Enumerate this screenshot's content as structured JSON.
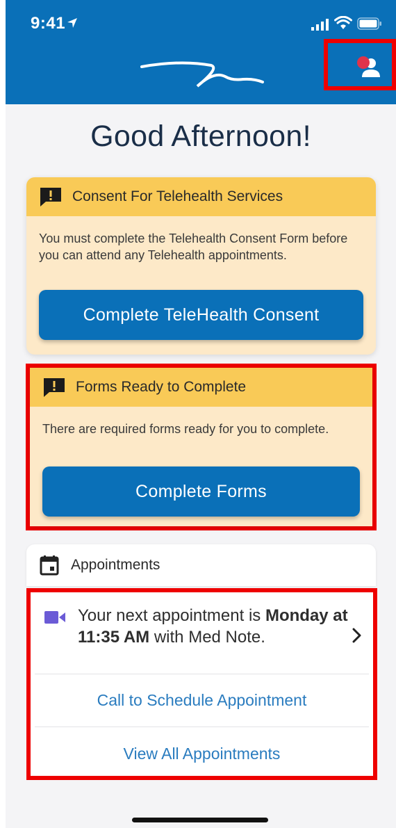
{
  "status_bar": {
    "time": "9:41"
  },
  "header": {
    "logo_icon": "brand-wave-logo",
    "profile_icon": "person-icon",
    "notification_color": "#e0334a",
    "background_color": "#0a70b8"
  },
  "greeting": "Good Afternoon!",
  "consent_card": {
    "title": "Consent For Telehealth Services",
    "message": "You must complete the Telehealth Consent Form before you can attend any Telehealth appointments.",
    "button_label": "Complete TeleHealth Consent"
  },
  "forms_card": {
    "title": "Forms Ready to Complete",
    "message": "There are required forms ready for you to complete.",
    "button_label": "Complete Forms"
  },
  "appointments": {
    "title": "Appointments",
    "next": {
      "prefix": "Your next appointment is",
      "when": "Monday at 11:35 AM",
      "mid": "with",
      "provider": "Med Note."
    },
    "call_link": "Call to Schedule Appointment",
    "view_link": "View All Appointments"
  },
  "colors": {
    "accent": "#0a70b8",
    "card_header": "#f9ca57",
    "card_body": "#fde9c8",
    "highlight": "#ee0000",
    "link": "#2a7cbf"
  }
}
